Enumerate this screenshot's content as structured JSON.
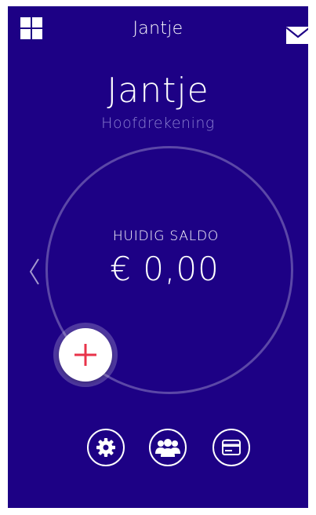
{
  "topbar": {
    "title": "Jantje",
    "menu_icon": "grid-icon",
    "mail_icon": "mail-icon"
  },
  "account": {
    "name": "Jantje",
    "type": "Hoofdrekening"
  },
  "balance": {
    "label": "HUIDIG SALDO",
    "amount": "€ 0,00"
  },
  "actions": {
    "add_icon": "plus-icon",
    "settings_icon": "gear-icon",
    "people_icon": "group-icon",
    "card_icon": "card-icon"
  },
  "colors": {
    "background": "#1d0185",
    "accent_red": "#e8334a",
    "subtitle": "#8a7fd0"
  }
}
